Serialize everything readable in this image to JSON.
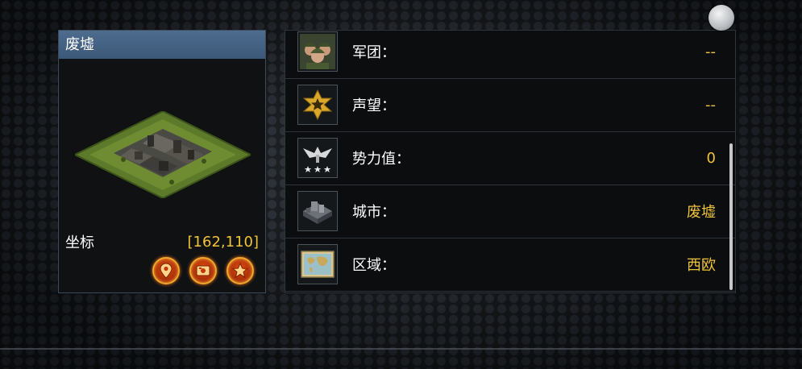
{
  "tile": {
    "title": "废墟",
    "coord_label": "坐标",
    "coord_value": "[162,110]",
    "actions": [
      {
        "icon": "location-pin-icon"
      },
      {
        "icon": "share-icon"
      },
      {
        "icon": "favorite-star-icon"
      }
    ]
  },
  "info": {
    "rows": [
      {
        "label": "军团：",
        "value": "--",
        "icon": "soldiers-icon"
      },
      {
        "label": "声望：",
        "value": "--",
        "icon": "gold-star-badge-icon"
      },
      {
        "label": "势力值：",
        "value": "0",
        "icon": "eagle-emblem-icon"
      },
      {
        "label": "城市：",
        "value": "废墟",
        "icon": "city-building-icon"
      },
      {
        "label": "区域：",
        "value": "西欧",
        "icon": "world-map-icon"
      }
    ]
  },
  "colors": {
    "accent_gold": "#f0c43a",
    "title_bar": "#4d6c8e",
    "action_button": "#e24a12"
  }
}
